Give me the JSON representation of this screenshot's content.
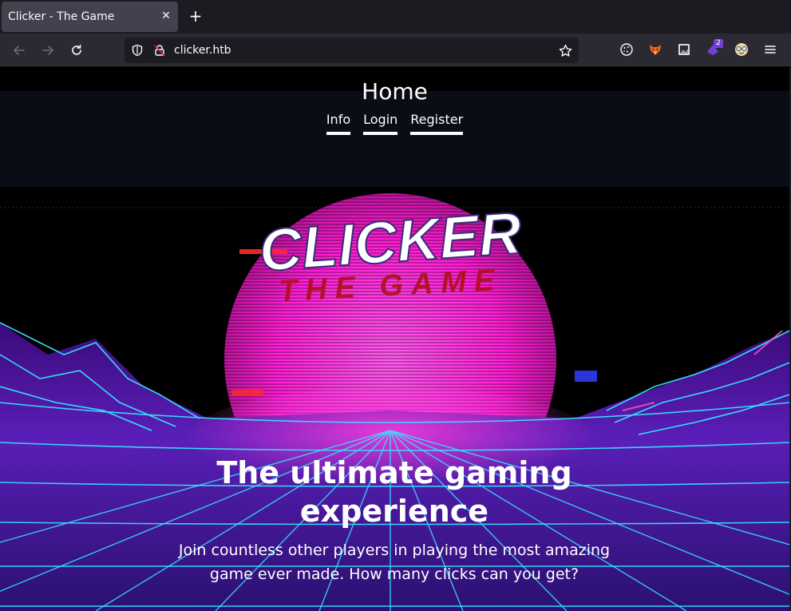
{
  "browser": {
    "tab_title": "Clicker - The Game",
    "tab_close_icon": "close-icon",
    "new_tab_icon": "plus-icon",
    "url": "clicker.htb",
    "extension_badge": "2"
  },
  "site": {
    "title": "Home",
    "nav": {
      "info": "Info",
      "login": "Login",
      "register": "Register"
    },
    "logo": {
      "line1": "CLICKER",
      "line2": "THE GAME"
    },
    "hero": {
      "heading": "The ultimate gaming experience",
      "subtext": "Join countless other players in playing the most amazing game ever made. How many clicks can you get?"
    }
  },
  "colors": {
    "sun": "#ff1fd6",
    "grid": "#35e6ff",
    "logo_red": "#b0101a"
  }
}
